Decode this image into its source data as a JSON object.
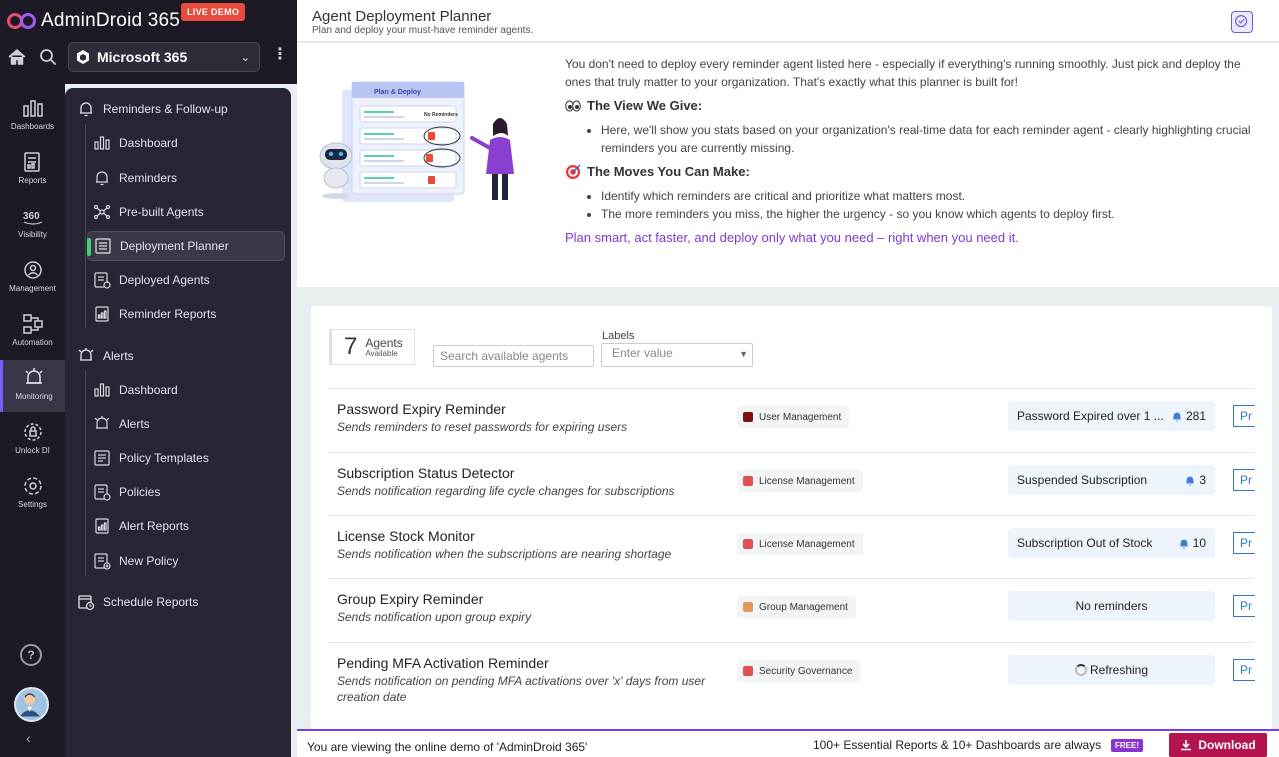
{
  "brand": {
    "name": "AdminDroid 365",
    "badge": "LIVE DEMO"
  },
  "tenant": {
    "selected": "Microsoft 365"
  },
  "rail": [
    {
      "label": "Dashboards",
      "icon": "bar-chart-icon"
    },
    {
      "label": "Reports",
      "icon": "report-icon"
    },
    {
      "label": "Visibility",
      "icon": "360-icon"
    },
    {
      "label": "Management",
      "icon": "users-gear-icon"
    },
    {
      "label": "Automation",
      "icon": "workflow-icon"
    },
    {
      "label": "Monitoring",
      "icon": "alarm-icon"
    },
    {
      "label": "Unlock DI",
      "icon": "gear-lock-icon"
    },
    {
      "label": "Settings",
      "icon": "gear-icon"
    }
  ],
  "sidebar": {
    "reminders_section": "Reminders & Follow-up",
    "reminders_items": [
      "Dashboard",
      "Reminders",
      "Pre-built Agents",
      "Deployment Planner",
      "Deployed Agents",
      "Reminder Reports"
    ],
    "alerts_section": "Alerts",
    "alerts_items": [
      "Dashboard",
      "Alerts",
      "Policy Templates",
      "Policies",
      "Alert Reports",
      "New Policy"
    ],
    "schedule_section": "Schedule Reports"
  },
  "header": {
    "title": "Agent Deployment Planner",
    "subtitle": "Plan and deploy your must-have reminder agents."
  },
  "intro": {
    "illustration_title": "Plan & Deploy",
    "illustration_tag": "No Reminders",
    "para": "You don't need to deploy every reminder agent listed here - especially if everything's running smoothly. Just pick and deploy the ones that truly matter to your organization. That's exactly what this planner is built for!",
    "view_heading": "The View We Give:",
    "view_points": [
      "Here, we'll show you stats based on your organization's real-time data for each reminder agent - clearly highlighting crucial reminders you are currently missing."
    ],
    "moves_heading": "The Moves You Can Make:",
    "moves_points": [
      "Identify which reminders are critical and prioritize what matters most.",
      "The more reminders you miss, the higher the urgency - so you know which agents to deploy first."
    ],
    "cta": "Plan smart, act faster, and deploy only what you need – right when you need it."
  },
  "filters": {
    "count": "7",
    "count_label": "Agents",
    "count_sub": "Available",
    "search_placeholder": "Search available agents",
    "labels_title": "Labels",
    "labels_placeholder": "Enter value"
  },
  "agents": [
    {
      "title": "Password Expiry Reminder",
      "desc": "Sends reminders to reset passwords for expiring users",
      "tag": "User Management",
      "tag_color": "#7a1010",
      "stat": "Password Expired over 1 ...",
      "count": "281",
      "action": "Pr"
    },
    {
      "title": "Subscription Status Detector",
      "desc": "Sends notification regarding life cycle changes for subscriptions",
      "tag": "License Management",
      "tag_color": "#e05050",
      "stat": "Suspended Subscription",
      "count": "3",
      "action": "Pr"
    },
    {
      "title": "License Stock Monitor",
      "desc": "Sends notification when the subscriptions are nearing shortage",
      "tag": "License Management",
      "tag_color": "#e05050",
      "stat": "Subscription Out of Stock",
      "count": "10",
      "action": "Pr"
    },
    {
      "title": "Group Expiry Reminder",
      "desc": "Sends notification upon group expiry",
      "tag": "Group Management",
      "tag_color": "#e09a5a",
      "stat": "No reminders",
      "count": "",
      "action": "Pr"
    },
    {
      "title": "Pending MFA Activation Reminder",
      "desc": "Sends notification on pending MFA activations over 'x' days from user creation date",
      "tag": "Security Governance",
      "tag_color": "#e05050",
      "stat": "Refreshing",
      "count": "",
      "action": "Pr"
    }
  ],
  "footer": {
    "left_prefix": "You are viewing the online demo of",
    "left_brand": "'AdminDroid 365'",
    "right_text": "100+ Essential Reports & 10+ Dashboards are always",
    "free": "FREE!",
    "download": "Download"
  },
  "colors": {
    "accent": "#7c3aed",
    "sidebar": "#292535",
    "rail": "#1d1a26",
    "download": "#b3134f"
  }
}
